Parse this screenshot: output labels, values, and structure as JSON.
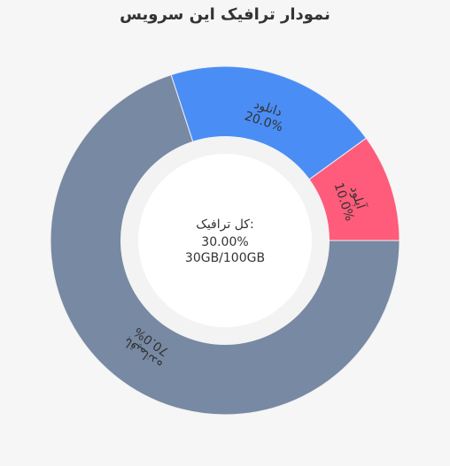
{
  "chart_data": {
    "type": "pie",
    "title": "نمودار ترافیک این سرویس",
    "categories": [
      "آپلود",
      "دانلود",
      "باقیمانده"
    ],
    "values": [
      10.0,
      20.0,
      70.0
    ],
    "value_labels": [
      "10.0%",
      "20.0%",
      "70.0%"
    ],
    "colors": [
      "#ff5b7a",
      "#4a8ef5",
      "#7789a3"
    ],
    "center_text": [
      "کل ترافیک:",
      "30.00%",
      "30GB/100GB"
    ]
  }
}
